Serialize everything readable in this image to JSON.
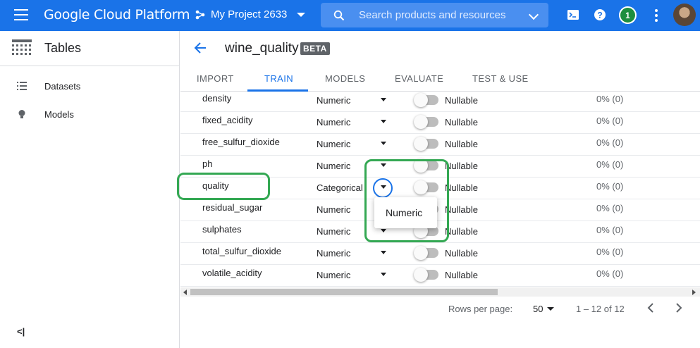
{
  "topbar": {
    "brand": "Google Cloud Platform",
    "project": "My Project 2633",
    "search_placeholder": "Search products and resources",
    "notification_count": "1",
    "color": "#1a73e8"
  },
  "sidebar": {
    "title": "Tables",
    "items": [
      {
        "label": "Datasets",
        "icon": "list-icon"
      },
      {
        "label": "Models",
        "icon": "lightbulb-icon"
      }
    ],
    "collapse_label": "<|"
  },
  "header": {
    "dataset_name": "wine_quality",
    "badge": "BETA"
  },
  "tabs": [
    {
      "label": "IMPORT",
      "active": false
    },
    {
      "label": "TRAIN",
      "active": true
    },
    {
      "label": "MODELS",
      "active": false
    },
    {
      "label": "EVALUATE",
      "active": false
    },
    {
      "label": "TEST & USE",
      "active": false
    }
  ],
  "table": {
    "rows": [
      {
        "name": "density",
        "type": "Numeric",
        "nullable": "Nullable",
        "missing": "0% (0)"
      },
      {
        "name": "fixed_acidity",
        "type": "Numeric",
        "nullable": "Nullable",
        "missing": "0% (0)"
      },
      {
        "name": "free_sulfur_dioxide",
        "type": "Numeric",
        "nullable": "Nullable",
        "missing": "0% (0)"
      },
      {
        "name": "ph",
        "type": "Numeric",
        "nullable": "Nullable",
        "missing": "0% (0)"
      },
      {
        "name": "quality",
        "type": "Categorical",
        "nullable": "Nullable",
        "missing": "0% (0)"
      },
      {
        "name": "residual_sugar",
        "type": "Numeric",
        "nullable": "Nullable",
        "missing": "0% (0)"
      },
      {
        "name": "sulphates",
        "type": "Numeric",
        "nullable": "Nullable",
        "missing": "0% (0)"
      },
      {
        "name": "total_sulfur_dioxide",
        "type": "Numeric",
        "nullable": "Nullable",
        "missing": "0% (0)"
      },
      {
        "name": "volatile_acidity",
        "type": "Numeric",
        "nullable": "Nullable",
        "missing": "0% (0)"
      }
    ]
  },
  "dropdown": {
    "options": [
      "Numeric"
    ]
  },
  "pagination": {
    "rows_per_page_label": "Rows per page:",
    "rows_per_page": "50",
    "range": "1 – 12 of 12"
  },
  "highlight_color": "#34a853"
}
